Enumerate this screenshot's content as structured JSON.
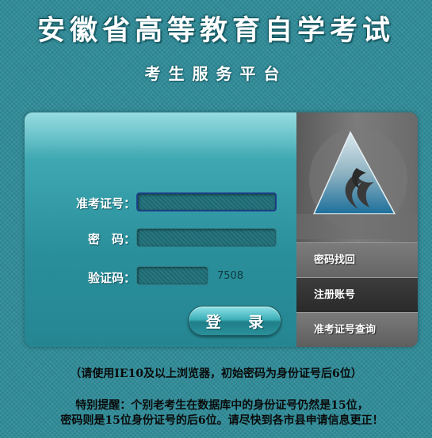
{
  "header": {
    "title": "安徽省高等教育自学考试",
    "subtitle": "考生服务平台"
  },
  "form": {
    "exam_number_label": "准考证号：",
    "password_label": "密　码：",
    "captcha_label": "验证码：",
    "exam_number_value": "",
    "password_value": "",
    "captcha_value": "",
    "captcha_code": "7508",
    "login_label": "登 录"
  },
  "side_menu": {
    "items": [
      {
        "label": "密码找回"
      },
      {
        "label": "注册账号"
      },
      {
        "label": "准考证号查询"
      }
    ]
  },
  "notes": {
    "browser_hint": "（请使用IE10及以上浏览器，初始密码为身份证号后6位）",
    "reminder_line1": "特别提醒：个别老考生在数据库中的身份证号仍然是15位，",
    "reminder_line2": "密码则是15位身份证号的后6位。请尽快到各市县申请信息更正！"
  },
  "colors": {
    "background": "#2f8c99",
    "panel_teal": "#3fa9b3",
    "side_gray": "#7c7c7c",
    "logo_blue": "#1c6f9b"
  }
}
